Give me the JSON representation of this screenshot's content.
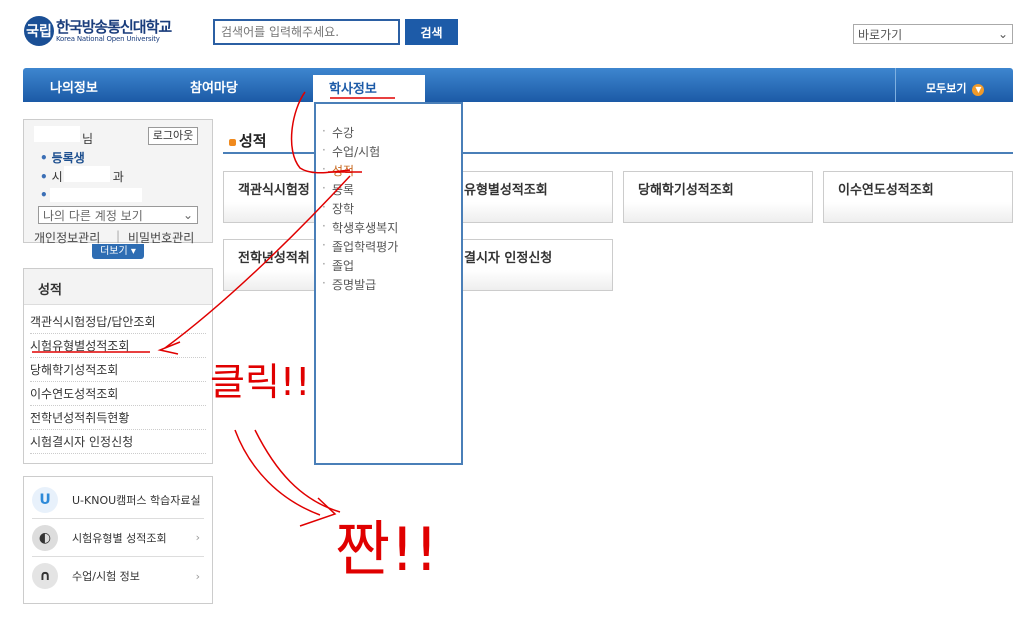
{
  "header": {
    "logo_mark": "국립",
    "logo_ko": "한국방송통신대학교",
    "logo_en": "Korea National Open University",
    "search_placeholder": "검색어를 입력해주세요.",
    "search_button": "검색",
    "quick_select": "바로가기"
  },
  "nav": {
    "items": [
      "나의정보",
      "참여마당",
      "학사정보"
    ],
    "view_all": "모두보기"
  },
  "dropdown": {
    "items": [
      "수강",
      "수업/시험",
      "성적",
      "등록",
      "장학",
      "학생후생복지",
      "졸업학력평가",
      "졸업",
      "증명발급"
    ]
  },
  "login": {
    "name_suffix": "님",
    "logout": "로그아웃",
    "status": "등록생",
    "dept_prefix": "시",
    "dept_suffix": "과",
    "other_account": "나의 다른 계정 보기",
    "personal_info": "개인정보관리",
    "password": "비밀번호관리",
    "separator": "|",
    "more": "더보기"
  },
  "left_menu": {
    "title": "성적",
    "items": [
      "객관식시험정답/답안조회",
      "시험유형별성적조회",
      "당해학기성적조회",
      "이수연도성적조회",
      "전학년성적취득현황",
      "시험결시자 인정신청"
    ]
  },
  "quick_links": [
    {
      "label": "U-KNOU캠퍼스 학습자료실",
      "icon": "u-logo-icon"
    },
    {
      "label": "시험유형별 성적조회",
      "icon": "headphone-icon"
    },
    {
      "label": "수업/시험 정보",
      "icon": "headset-icon"
    }
  ],
  "content": {
    "title": "성적",
    "cards": [
      "객관식시험정",
      "유형별성적조회",
      "당해학기성적조회",
      "이수연도성적조회",
      "전학년성적취",
      "결시자 인정신청"
    ]
  },
  "annotations": {
    "click_text": "클릭!!",
    "zzan_text": "짠!!"
  },
  "colors": {
    "nav": "#1d5ba8",
    "accent": "#f08a1e",
    "annotation": "#e00000"
  }
}
